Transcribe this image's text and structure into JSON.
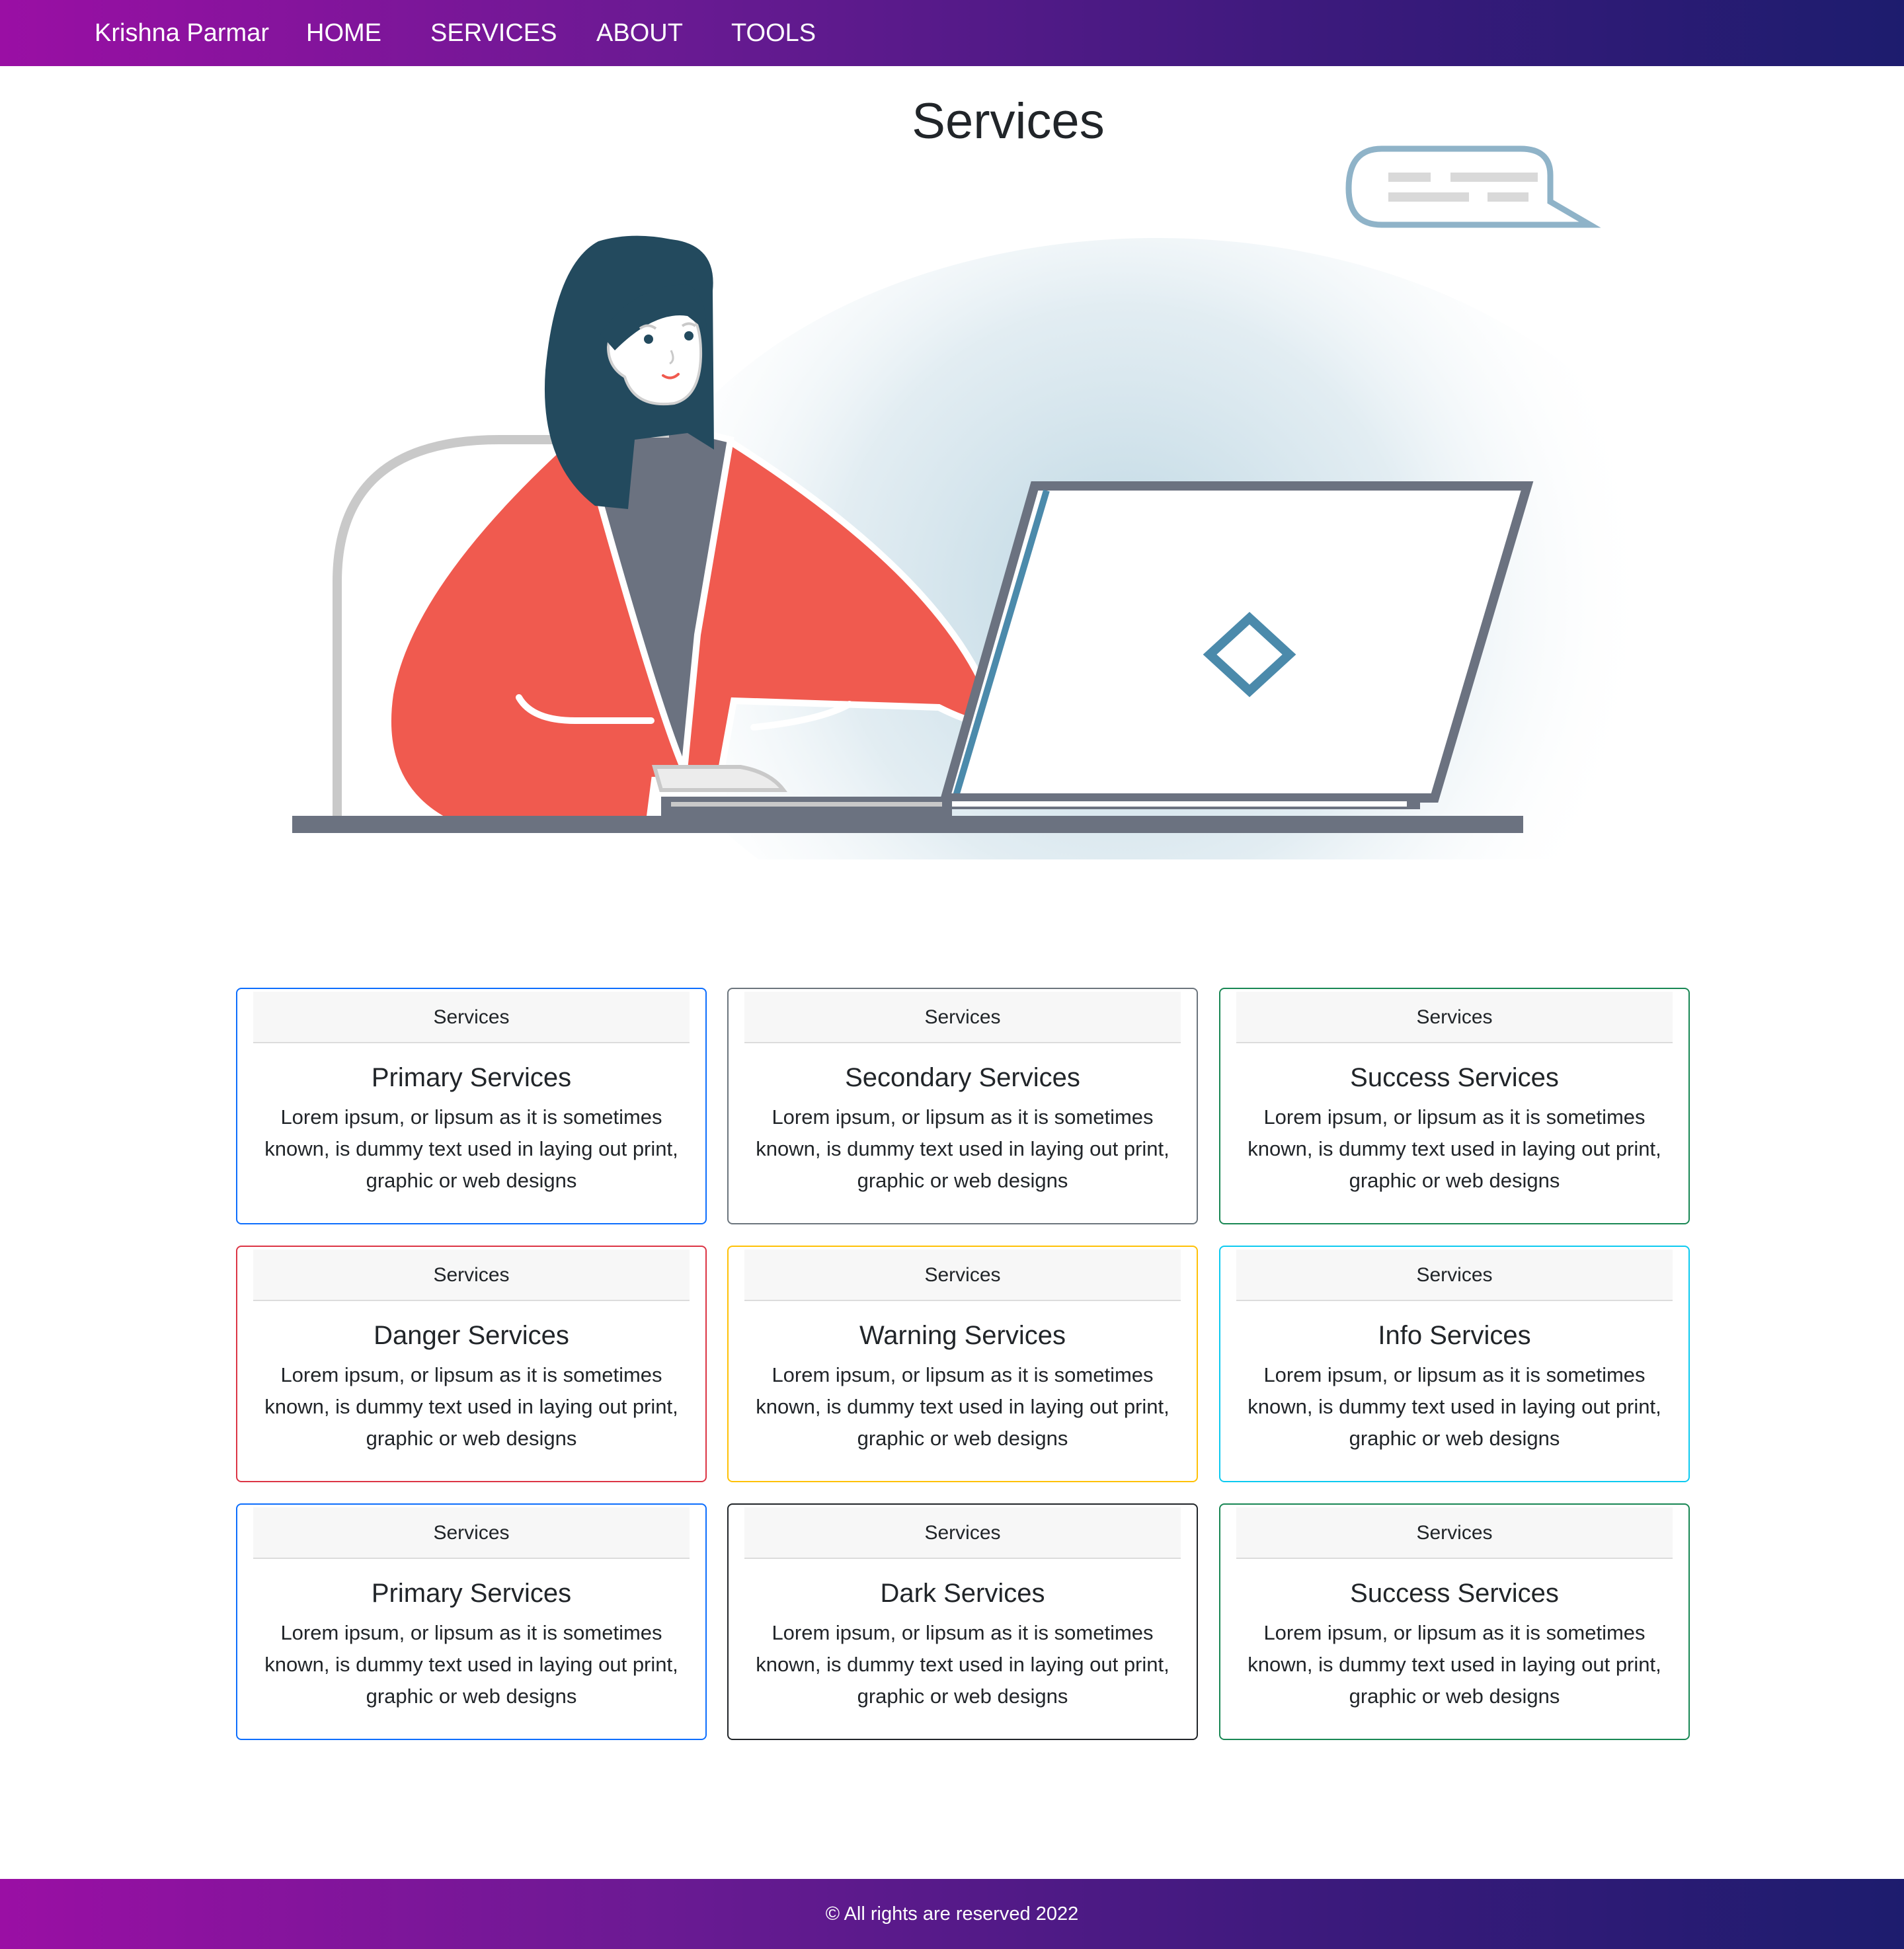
{
  "navbar": {
    "brand": "Krishna Parmar",
    "links": [
      "HOME",
      "SERVICES",
      "ABOUT",
      "TOOLS"
    ]
  },
  "page": {
    "title": "Services"
  },
  "hero": {
    "illustration": "woman-at-laptop-illustration",
    "colors": {
      "hair": "#234a5e",
      "jacket": "#f05a4f",
      "laptop": "#6b7280",
      "accent": "#4b8aab"
    }
  },
  "cards": [
    {
      "header": "Services",
      "title": "Primary Services",
      "text": "Lorem ipsum, or lipsum as it is sometimes known, is dummy text used in laying out print, graphic or web designs",
      "color": "#0d6efd"
    },
    {
      "header": "Services",
      "title": "Secondary Services",
      "text": "Lorem ipsum, or lipsum as it is sometimes known, is dummy text used in laying out print, graphic or web designs",
      "color": "#6c757d"
    },
    {
      "header": "Services",
      "title": "Success Services",
      "text": "Lorem ipsum, or lipsum as it is sometimes known, is dummy text used in laying out print, graphic or web designs",
      "color": "#198754"
    },
    {
      "header": "Services",
      "title": "Danger Services",
      "text": "Lorem ipsum, or lipsum as it is sometimes known, is dummy text used in laying out print, graphic or web designs",
      "color": "#dc3545"
    },
    {
      "header": "Services",
      "title": "Warning Services",
      "text": "Lorem ipsum, or lipsum as it is sometimes known, is dummy text used in laying out print, graphic or web designs",
      "color": "#ffc107"
    },
    {
      "header": "Services",
      "title": "Info Services",
      "text": "Lorem ipsum, or lipsum as it is sometimes known, is dummy text used in laying out print, graphic or web designs",
      "color": "#0dcaf0"
    },
    {
      "header": "Services",
      "title": "Primary Services",
      "text": "Lorem ipsum, or lipsum as it is sometimes known, is dummy text used in laying out print, graphic or web designs",
      "color": "#0d6efd"
    },
    {
      "header": "Services",
      "title": "Dark Services",
      "text": "Lorem ipsum, or lipsum as it is sometimes known, is dummy text used in laying out print, graphic or web designs",
      "color": "#212529"
    },
    {
      "header": "Services",
      "title": "Success Services",
      "text": "Lorem ipsum, or lipsum as it is sometimes known, is dummy text used in laying out print, graphic or web designs",
      "color": "#198754"
    }
  ],
  "footer": {
    "text": "© All rights are reserved 2022"
  },
  "theme": {
    "gradient": [
      "#9a0fa4",
      "#1d1c6e"
    ]
  }
}
